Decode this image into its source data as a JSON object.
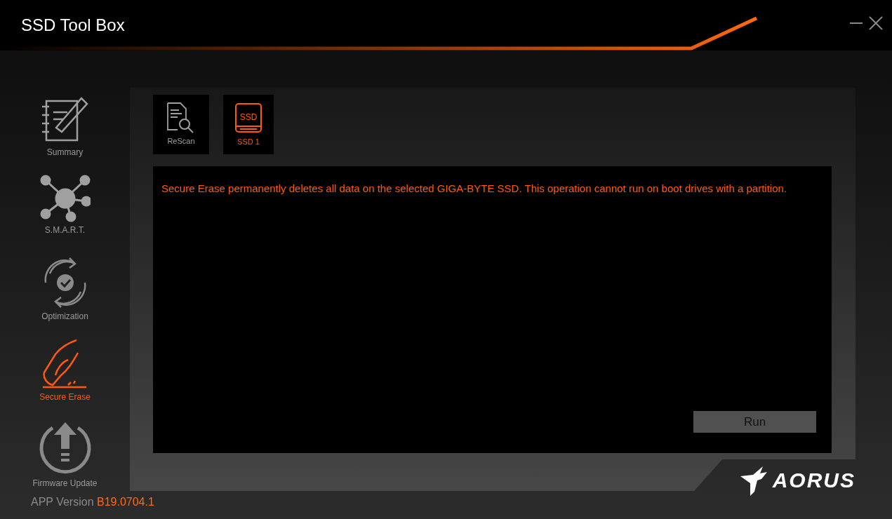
{
  "window": {
    "title": "SSD Tool Box",
    "controls": [
      {
        "kind": "minimize"
      },
      {
        "kind": "close"
      }
    ]
  },
  "sidebar": {
    "items": [
      {
        "kind": "summary",
        "label": "Summary",
        "selected": false
      },
      {
        "kind": "smart",
        "label": "S.M.A.R.T.",
        "selected": false
      },
      {
        "kind": "optimization",
        "label": "Optimization",
        "selected": false
      },
      {
        "kind": "erase",
        "label": "Secure Erase",
        "selected": true
      },
      {
        "kind": "firmware",
        "label": "Firmware Update",
        "selected": false
      }
    ]
  },
  "app_version": {
    "label": "APP Version",
    "value": "B19.0704.1"
  },
  "toolbar": [
    {
      "kind": "rescan",
      "label": "ReScan",
      "selected": false
    },
    {
      "kind": "ssd",
      "label": "SSD 1",
      "icon_text": "SSD",
      "selected": true
    }
  ],
  "message": "Secure Erase permanently deletes all data on the selected GIGA-BYTE SSD. This operation cannot run on boot drives with a partition.",
  "run_button": {
    "label": "Run"
  },
  "brand": {
    "name": "AORUS"
  }
}
